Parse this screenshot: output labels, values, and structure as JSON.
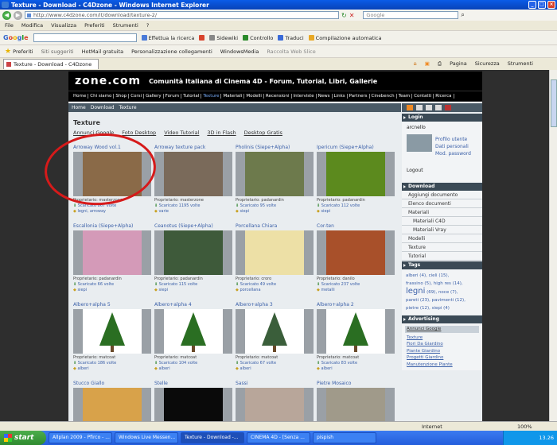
{
  "window": {
    "title": "Texture - Download - C4Dzone - Windows Internet Explorer"
  },
  "address": {
    "url": "http://www.c4dzone.com/it/download/texture-2/",
    "search_placeholder": "Google"
  },
  "menu": [
    "File",
    "Modifica",
    "Visualizza",
    "Preferiti",
    "Strumenti",
    "?"
  ],
  "google_toolbar": {
    "logo": "Google",
    "items": [
      "Effettua la ricerca",
      "Sidewiki",
      "Controllo",
      "Traduci",
      "Compilazione automatica"
    ]
  },
  "favorites_bar": {
    "label": "Preferiti",
    "items": [
      "Siti suggeriti",
      "HotMail gratuita",
      "Personalizzazione collegamenti",
      "WindowsMedia",
      "Raccolta Web Slice"
    ]
  },
  "tab": {
    "label": "Texture - Download - C4Dzone"
  },
  "tab_tools": [
    "Pagina",
    "Sicurezza",
    "Strumenti"
  ],
  "site": {
    "logo": "zone.com",
    "tagline": "Comunità Italiana di Cinema 4D - Forum, Tutorial, Libri, Gallerie",
    "nav": [
      "Home",
      "Chi siamo",
      "Shop",
      "Corsi",
      "Gallery",
      "Forum",
      "Tutorial",
      "Texture",
      "Materiali",
      "Modelli",
      "Recensioni",
      "Interviste",
      "News",
      "Links",
      "Partners",
      "Cinebench",
      "Team",
      "Contatti",
      "Ricerca"
    ],
    "nav_active": "Texture",
    "breadcrumb": [
      "Home",
      "Download",
      "Texture"
    ],
    "section_title": "Texture",
    "subtabs": [
      "Annunci Google",
      "Foto Desktop",
      "Video Tutorial",
      "3D in Flash",
      "Desktop Gratis"
    ]
  },
  "items": [
    {
      "title": "Arroway Wood vol.1",
      "owner": "Proprietario: masterzone",
      "downloads": "Scaricato 867 volte",
      "tags": "legni, arroway",
      "color": "#8a6a48"
    },
    {
      "title": "Arroway texture pack",
      "owner": "Proprietario: masterzone",
      "downloads": "Scaricato 1195 volte",
      "tags": "varie",
      "color": "#7a6a5a"
    },
    {
      "title": "Pholinis (Siepe+Alpha)",
      "owner": "Proprietario: padanardin",
      "downloads": "Scaricato 95 volte",
      "tags": "siepi",
      "color": "#6d7a4c"
    },
    {
      "title": "Ipericum (Siepe+Alpha)",
      "owner": "Proprietario: padanardin",
      "downloads": "Scaricato 112 volte",
      "tags": "siepi",
      "color": "#5c8a1e"
    },
    {
      "title": "Escallonia (Siepe+Alpha)",
      "owner": "Proprietario: padanardin",
      "downloads": "Scaricato 66 volte",
      "tags": "siepi",
      "color": "#d49ab8"
    },
    {
      "title": "Ceanotus (Siepe+Alpha)",
      "owner": "Proprietario: padanardin",
      "downloads": "Scaricato 115 volte",
      "tags": "siepi",
      "color": "#3e5a3a"
    },
    {
      "title": "Porcellana Chiara",
      "owner": "Proprietario: croro",
      "downloads": "Scaricato 49 volte",
      "tags": "porcellana",
      "color": "#ede0a6"
    },
    {
      "title": "Cor-ten",
      "owner": "Proprietario: danilo",
      "downloads": "Scaricato 237 volte",
      "tags": "metalli",
      "color": "#a8502a"
    },
    {
      "title": "Albero+alpha 5",
      "owner": "Proprietario: matcoat",
      "downloads": "Scaricato 186 volte",
      "tags": "alberi",
      "color": "#2a6e22"
    },
    {
      "title": "Albero+alpha 4",
      "owner": "Proprietario: matcoat",
      "downloads": "Scaricato 104 volte",
      "tags": "alberi",
      "color": "#2a6e22"
    },
    {
      "title": "Albero+alpha 3",
      "owner": "Proprietario: matcoat",
      "downloads": "Scaricato 67 volte",
      "tags": "alberi",
      "color": "#3a5e3a"
    },
    {
      "title": "Albero+alpha 2",
      "owner": "Proprietario: matcoat",
      "downloads": "Scaricato 83 volte",
      "tags": "alberi",
      "color": "#2a6e22"
    },
    {
      "title": "Stucco Giallo",
      "owner": "",
      "downloads": "",
      "tags": "",
      "color": "#d8a24a"
    },
    {
      "title": "Stelle",
      "owner": "",
      "downloads": "",
      "tags": "",
      "color": "#0a0a0a"
    },
    {
      "title": "Sassi",
      "owner": "",
      "downloads": "",
      "tags": "",
      "color": "#b8a69a"
    },
    {
      "title": "Pietre Mosaico",
      "owner": "",
      "downloads": "",
      "tags": "",
      "color": "#a09a8a"
    }
  ],
  "sidebar": {
    "login": {
      "title": "Login",
      "user": "arcnello",
      "links": [
        "Profilo utente",
        "Dati personali",
        "Mod. password"
      ],
      "logout": "Logout"
    },
    "download": {
      "title": "Download",
      "items": [
        "Aggiungi documento",
        "Elenco documenti",
        "Materiali",
        "Materiali C4D",
        "Materiali Vray",
        "Modelli",
        "Texture",
        "Tutorial"
      ]
    },
    "tags": {
      "title": "Tags",
      "line1": "alberi (4), cieli (15),",
      "line2": "frassino (5), high res (14),",
      "big": "legni",
      "line3": "(69), noce (7),",
      "line4": "pareti (23), pavimenti (12),",
      "line5": "pietre (12), siepi (4)"
    },
    "advertising": {
      "title": "Advertising",
      "header": "Annunci Google",
      "links": [
        "Texture",
        "Fiori Da Giardino",
        "Piante Giardino",
        "Progetti Giardino",
        "Manutenzione Piante"
      ]
    }
  },
  "statusbar": {
    "zone": "Internet",
    "zoom": "100%"
  },
  "taskbar": {
    "start": "start",
    "tasks": [
      "Allplan 2009 - Pfirco - ...",
      "Windows Live Messen...",
      "Texture - Download -...",
      "CINEMA 4D - [Senza ...",
      "pispish"
    ],
    "clock": "13.26"
  }
}
